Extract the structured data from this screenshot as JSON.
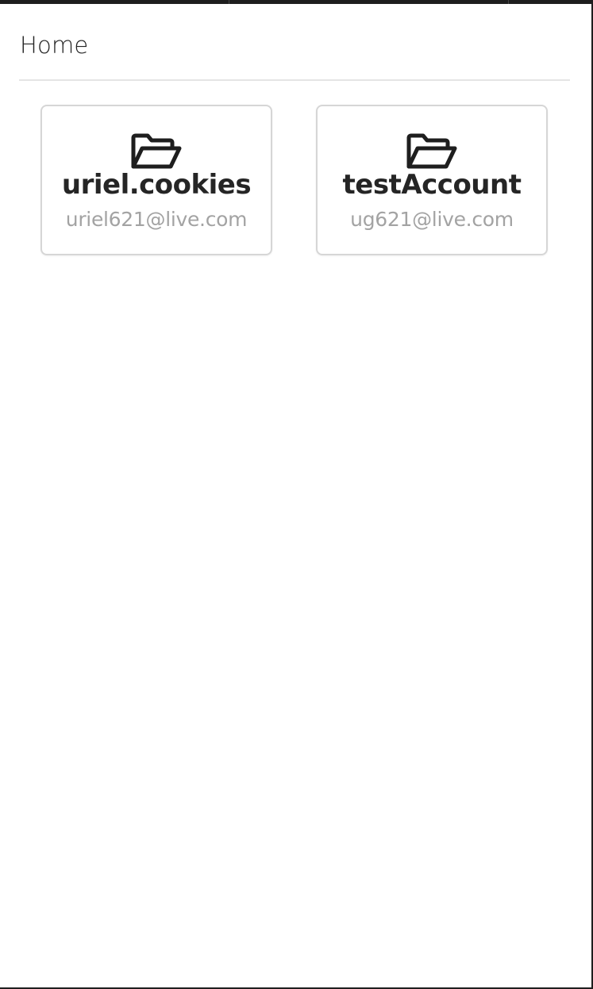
{
  "header": {
    "title": "Home"
  },
  "accounts": [
    {
      "name": "uriel.cookies",
      "email": "uriel621@live.com",
      "icon": "folder-open-icon"
    },
    {
      "name": "testAccount",
      "email": "ug621@live.com",
      "icon": "folder-open-icon"
    }
  ],
  "colors": {
    "frame": "#1e1e1e",
    "title_text": "#222222",
    "divider": "#e4e4e4",
    "card_border": "#d6d6d6",
    "name_text": "#252525",
    "email_text": "#a3a3a3"
  }
}
